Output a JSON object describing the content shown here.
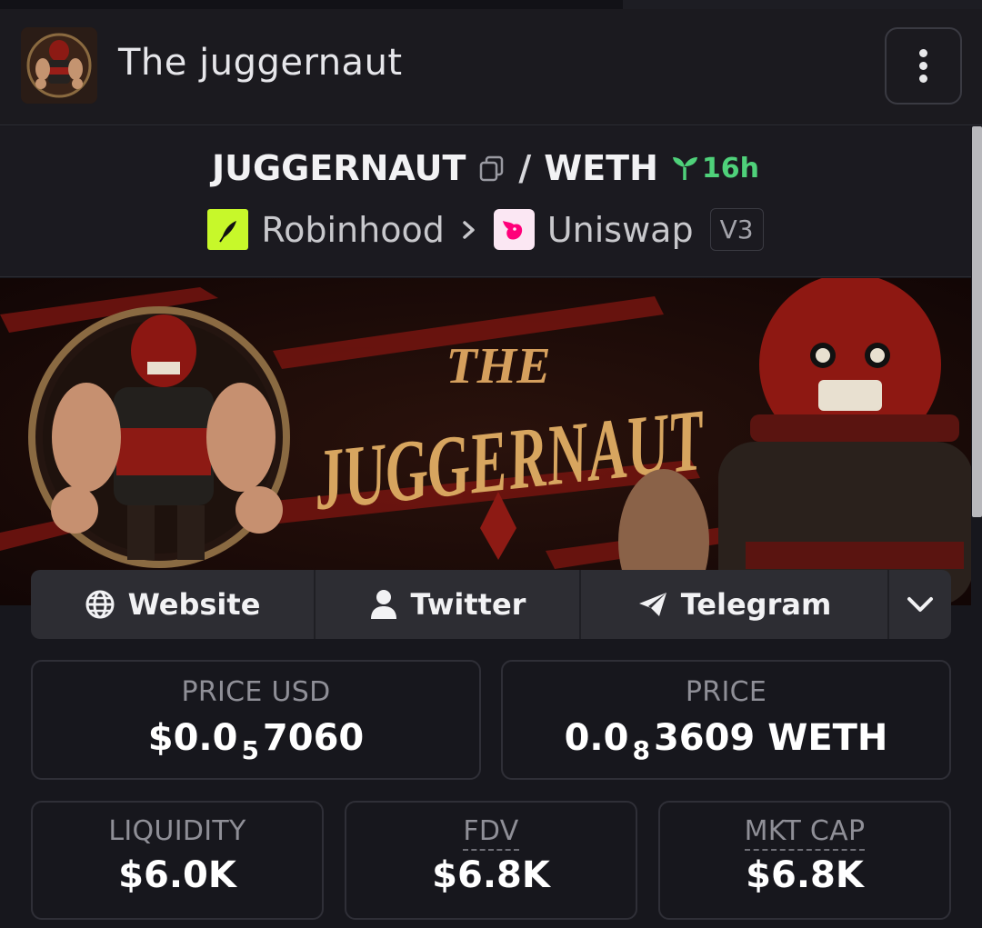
{
  "header": {
    "title": "The juggernaut"
  },
  "pair": {
    "base": "JUGGERNAUT",
    "separator": "/",
    "quote": "WETH",
    "age": "16h",
    "chain": "Robinhood",
    "dex": "Uniswap",
    "version": "V3"
  },
  "banner": {
    "line1": "THE",
    "line2": "JUGGERNAUT"
  },
  "socials": {
    "website": "Website",
    "twitter": "Twitter",
    "telegram": "Telegram"
  },
  "stats": {
    "price_usd": {
      "label": "PRICE USD",
      "prefix": "$0.0",
      "zeros": "5",
      "digits": "7060"
    },
    "price": {
      "label": "PRICE",
      "prefix": "0.0",
      "zeros": "8",
      "digits": "3609 WETH"
    },
    "liquidity": {
      "label": "LIQUIDITY",
      "value": "$6.0K"
    },
    "fdv": {
      "label": "FDV",
      "value": "$6.8K"
    },
    "mkt_cap": {
      "label": "MKT CAP",
      "value": "$6.8K"
    }
  },
  "colors": {
    "accent_green": "#4fd17a",
    "robinhood_green": "#c7f82a",
    "uniswap_pink": "#ff007a",
    "background": "#17171d"
  },
  "icons": [
    "menu-icon",
    "copy-icon",
    "sprout-icon",
    "chevron-right-icon",
    "globe-icon",
    "user-icon",
    "send-icon",
    "chevron-down-icon"
  ]
}
